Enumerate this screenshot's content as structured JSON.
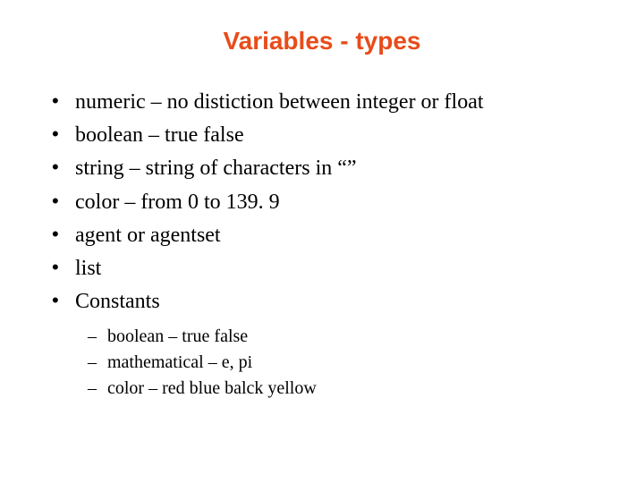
{
  "title": "Variables - types",
  "bullets": [
    "numeric – no distiction between integer or float",
    "boolean – true false",
    "string – string of characters in “”",
    "color – from 0 to 139. 9",
    "agent or agentset",
    "list",
    "Constants"
  ],
  "sub_bullets": [
    "boolean – true false",
    "mathematical – e, pi",
    "color – red blue balck yellow"
  ]
}
